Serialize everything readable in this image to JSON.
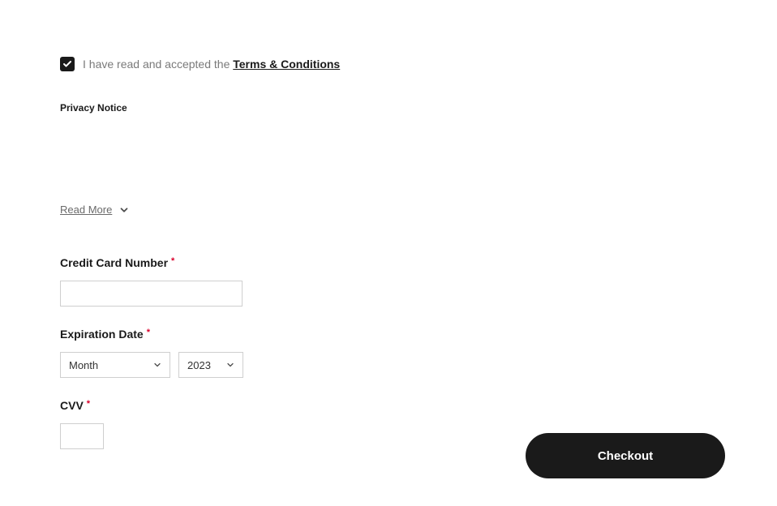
{
  "terms": {
    "text_prefix": "I have read and accepted the ",
    "link_label": "Terms & Conditions",
    "checked": true
  },
  "privacy": {
    "heading": "Privacy Notice",
    "read_more_label": "Read More"
  },
  "payment": {
    "cc_label": "Credit Card Number",
    "cc_value": "",
    "exp_label": "Expiration Date",
    "exp_month_value": "Month",
    "exp_year_value": "2023",
    "cvv_label": "CVV",
    "cvv_value": ""
  },
  "actions": {
    "checkout_label": "Checkout"
  }
}
